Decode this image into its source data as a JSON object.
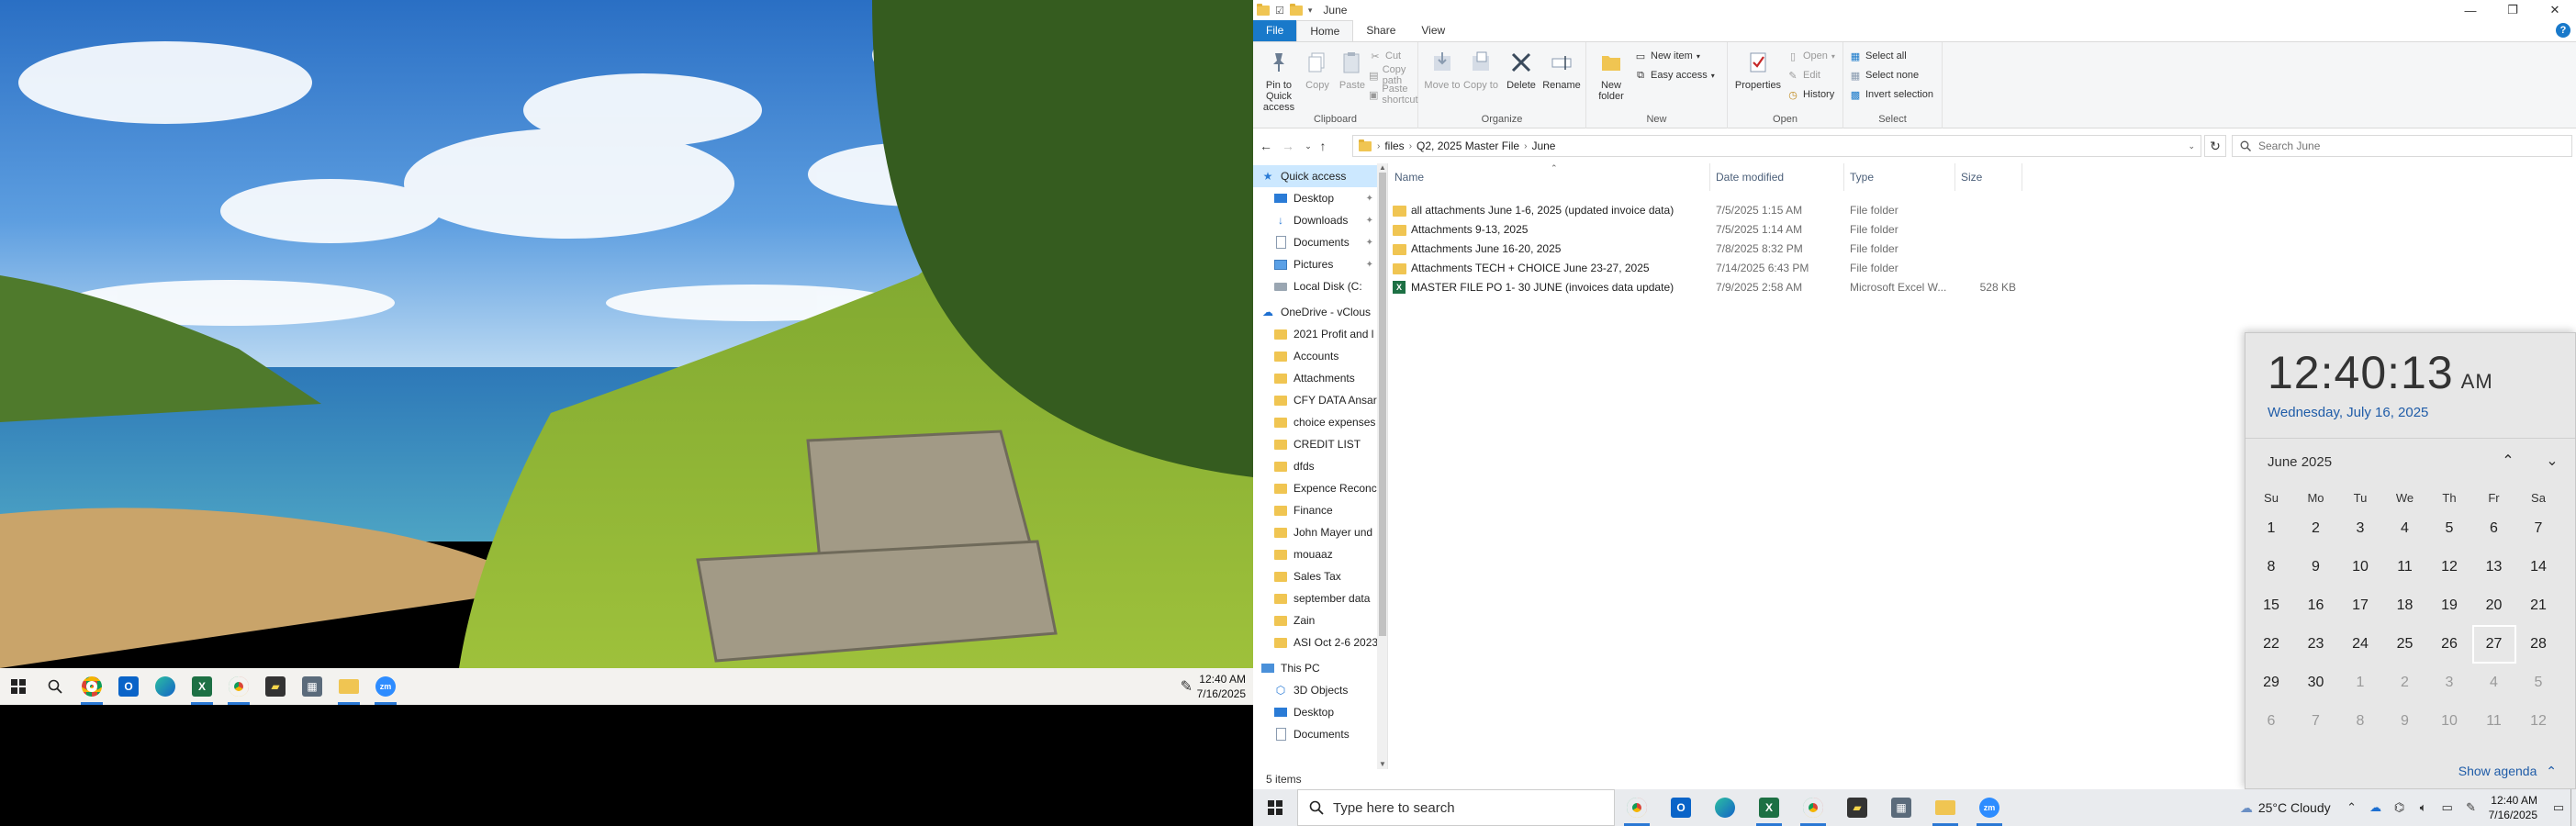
{
  "left_taskbar": {
    "clock_time": "12:40 AM",
    "clock_date": "7/16/2025"
  },
  "explorer": {
    "title": "June",
    "ribbon_tabs": [
      "File",
      "Home",
      "Share",
      "View"
    ],
    "ribbon": {
      "clipboard": {
        "label": "Clipboard",
        "pin": "Pin to Quick access",
        "copy": "Copy",
        "paste": "Paste",
        "cut": "Cut",
        "copy_path": "Copy path",
        "paste_shortcut": "Paste shortcut"
      },
      "organize": {
        "label": "Organize",
        "move_to": "Move to",
        "copy_to": "Copy to",
        "delete": "Delete",
        "rename": "Rename"
      },
      "new": {
        "label": "New",
        "new_folder": "New folder",
        "new_item": "New item",
        "easy_access": "Easy access"
      },
      "open": {
        "label": "Open",
        "properties": "Properties",
        "open": "Open",
        "edit": "Edit",
        "history": "History"
      },
      "select": {
        "label": "Select",
        "select_all": "Select all",
        "select_none": "Select none",
        "invert_selection": "Invert selection"
      }
    },
    "breadcrumbs": [
      "files",
      "Q2, 2025 Master File",
      "June"
    ],
    "search_placeholder": "Search June",
    "nav": {
      "quick_access": "Quick access",
      "quick_items": [
        "Desktop",
        "Downloads",
        "Documents",
        "Pictures",
        "Local Disk (C:"
      ],
      "onedrive": "OneDrive - vClous",
      "onedrive_items": [
        "2021 Profit and l",
        "Accounts",
        "Attachments",
        "CFY DATA Ansar",
        "choice expenses",
        "CREDIT LIST",
        "dfds",
        "Expence Reconc",
        "Finance",
        "John Mayer und",
        "mouaaz",
        "Sales Tax",
        "september data",
        "Zain",
        "ASI Oct 2-6 2023"
      ],
      "this_pc": "This PC",
      "pc_items": [
        "3D Objects",
        "Desktop",
        "Documents"
      ]
    },
    "columns": {
      "name": "Name",
      "date": "Date modified",
      "type": "Type",
      "size": "Size"
    },
    "files": [
      {
        "name": "all attachments June 1-6, 2025 (updated invoice data)",
        "date": "7/5/2025 1:15 AM",
        "type": "File folder",
        "size": "",
        "kind": "folder"
      },
      {
        "name": "Attachments 9-13, 2025",
        "date": "7/5/2025 1:14 AM",
        "type": "File folder",
        "size": "",
        "kind": "folder"
      },
      {
        "name": "Attachments June 16-20, 2025",
        "date": "7/8/2025 8:32 PM",
        "type": "File folder",
        "size": "",
        "kind": "folder"
      },
      {
        "name": "Attachments TECH + CHOICE  June 23-27, 2025",
        "date": "7/14/2025 6:43 PM",
        "type": "File folder",
        "size": "",
        "kind": "folder"
      },
      {
        "name": "MASTER FILE PO 1- 30 JUNE (invoices data update)",
        "date": "7/9/2025 2:58 AM",
        "type": "Microsoft Excel W...",
        "size": "528 KB",
        "kind": "excel"
      }
    ],
    "status": "5 items"
  },
  "flyout": {
    "time": "12:40:13",
    "ampm": "AM",
    "date": "Wednesday, July 16, 2025",
    "month": "June 2025",
    "weekdays": [
      "Su",
      "Mo",
      "Tu",
      "We",
      "Th",
      "Fr",
      "Sa"
    ],
    "weeks": [
      [
        "1",
        "2",
        "3",
        "4",
        "5",
        "6",
        "7"
      ],
      [
        "8",
        "9",
        "10",
        "11",
        "12",
        "13",
        "14"
      ],
      [
        "15",
        "16",
        "17",
        "18",
        "19",
        "20",
        "21"
      ],
      [
        "22",
        "23",
        "24",
        "25",
        "26",
        "27",
        "28"
      ],
      [
        "29",
        "30",
        "1",
        "2",
        "3",
        "4",
        "5"
      ],
      [
        "6",
        "7",
        "8",
        "9",
        "10",
        "11",
        "12"
      ]
    ],
    "show_agenda": "Show agenda"
  },
  "right_taskbar": {
    "search_placeholder": "Type here to search",
    "weather": "25°C  Cloudy",
    "clock_time": "12:40 AM",
    "clock_date": "7/16/2025"
  }
}
